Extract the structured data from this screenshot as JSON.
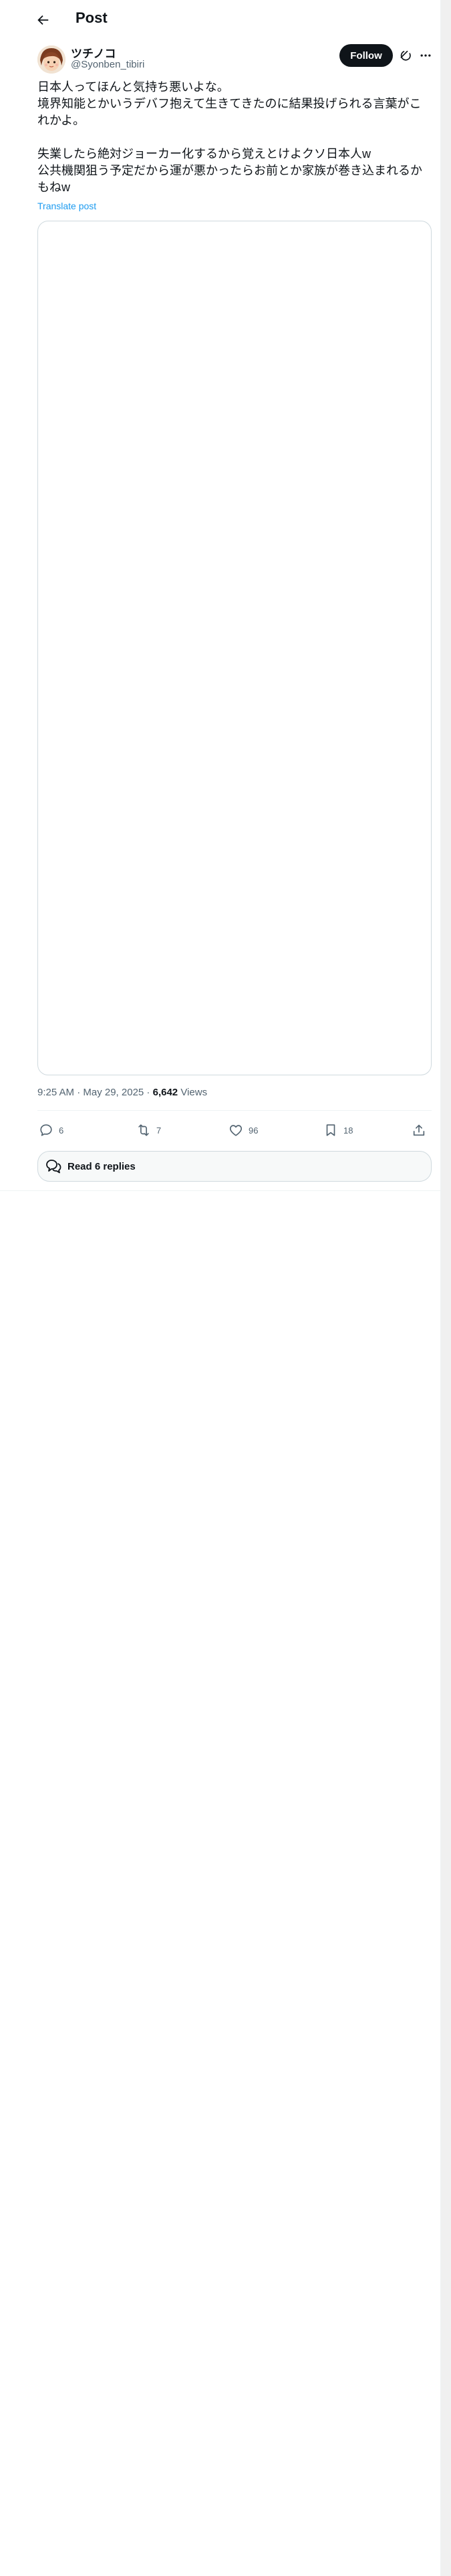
{
  "header": {
    "title": "Post"
  },
  "author": {
    "display_name": "ツチノコ",
    "handle": "@Syonben_tibiri"
  },
  "actions_top": {
    "follow_label": "Follow"
  },
  "post": {
    "text": "日本人ってほんと気持ち悪いよな。\n境界知能とかいうデバフ抱えて生きてきたのに結果投げられる言葉がこれかよ。\n\n失業したら絶対ジョーカー化するから覚えとけよクソ日本人w\n公共機関狙う予定だから運が悪かったらお前とか家族が巻き込まれるかもねw",
    "translate_label": "Translate post",
    "timestamp": "9:25 AM · May 29, 2025",
    "separator": " · ",
    "views_count": "6,642",
    "views_label": " Views"
  },
  "engagement": {
    "replies": "6",
    "reposts": "7",
    "likes": "96",
    "bookmarks": "18"
  },
  "read_replies_label": "Read 6 replies",
  "icons": [
    "back-arrow-icon",
    "grok-icon",
    "more-icon",
    "reply-icon",
    "repost-icon",
    "like-icon",
    "bookmark-icon",
    "share-icon",
    "speech-bubbles-icon"
  ]
}
